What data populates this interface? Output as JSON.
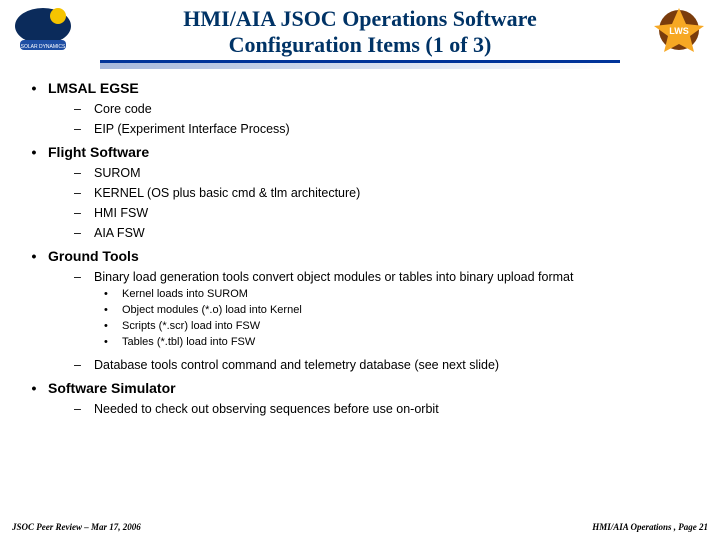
{
  "title_line1": "HMI/AIA JSOC Operations Software",
  "title_line2": "Configuration Items (1 of 3)",
  "sections": [
    {
      "label": "LMSAL EGSE",
      "subs": [
        {
          "label": "Core code"
        },
        {
          "label": "EIP (Experiment Interface Process)"
        }
      ]
    },
    {
      "label": "Flight Software",
      "subs": [
        {
          "label": "SUROM"
        },
        {
          "label": "KERNEL (OS plus basic cmd & tlm architecture)"
        },
        {
          "label": "HMI FSW"
        },
        {
          "label": "AIA FSW"
        }
      ]
    },
    {
      "label": "Ground Tools",
      "subs": [
        {
          "label": "Binary load generation tools convert object modules or tables into binary upload format",
          "subs": [
            {
              "label": "Kernel loads into SUROM"
            },
            {
              "label": "Object modules (*.o) load into Kernel"
            },
            {
              "label": "Scripts (*.scr) load into FSW"
            },
            {
              "label": "Tables (*.tbl) load into FSW"
            }
          ]
        },
        {
          "label": "Database tools control command and telemetry database (see next slide)"
        }
      ]
    },
    {
      "label": "Software Simulator",
      "subs": [
        {
          "label": "Needed to check out observing sequences before use on-orbit"
        }
      ]
    }
  ],
  "footer_left": "JSOC Peer Review – Mar 17, 2006",
  "footer_right": "HMI/AIA Operations , Page 21"
}
